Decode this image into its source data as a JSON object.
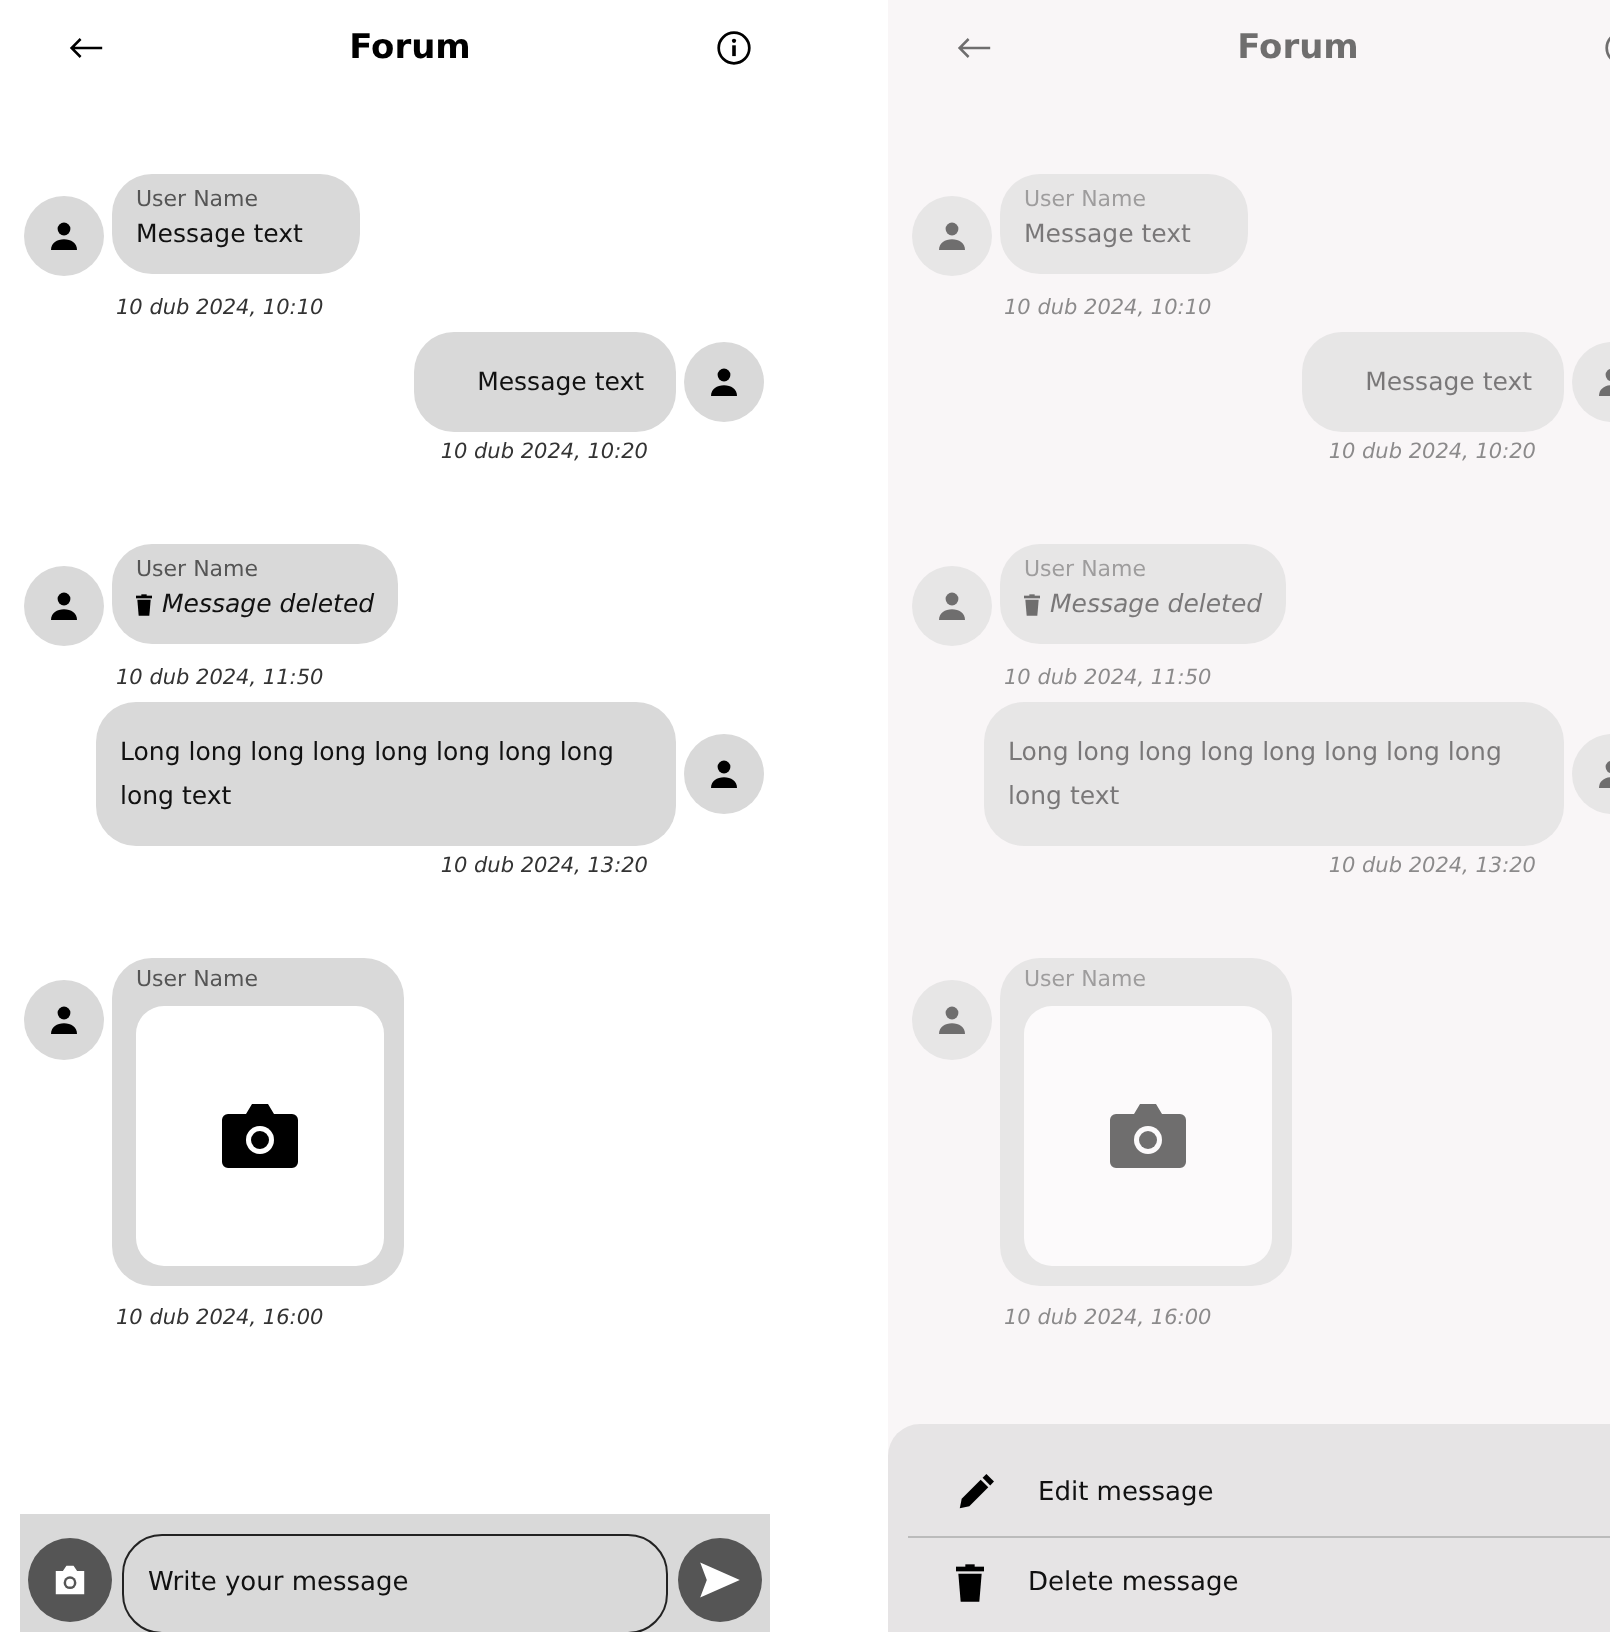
{
  "screens": [
    {
      "kind": "chat",
      "dimmed": false,
      "header": {
        "title": "Forum"
      },
      "messages": [
        {
          "kind": "incoming",
          "author": "User Name",
          "text": "Message text",
          "time": "10 dub 2024, 10:10"
        },
        {
          "kind": "outgoing",
          "text": "Message text",
          "time": "10 dub 2024, 10:20"
        },
        {
          "kind": "deleted",
          "author": "User Name",
          "text": "Message deleted",
          "time": "10 dub 2024, 11:50"
        },
        {
          "kind": "outgoing",
          "text": "Long long long long long long long long long text",
          "time": "10 dub 2024, 13:20"
        },
        {
          "kind": "photo",
          "author": "User Name",
          "time": "10 dub 2024, 16:00"
        }
      ],
      "composer": {
        "placeholder": "Write your message"
      }
    },
    {
      "kind": "chat",
      "dimmed": true,
      "header": {
        "title": "Forum"
      },
      "messages": [
        {
          "kind": "incoming",
          "author": "User Name",
          "text": "Message text",
          "time": "10 dub 2024, 10:10"
        },
        {
          "kind": "outgoing",
          "text": "Message text",
          "time": "10 dub 2024, 10:20"
        },
        {
          "kind": "deleted",
          "author": "User Name",
          "text": "Message deleted",
          "time": "10 dub 2024, 11:50"
        },
        {
          "kind": "outgoing",
          "text": "Long long long long long long long long long text",
          "time": "10 dub 2024, 13:20"
        },
        {
          "kind": "photo",
          "author": "User Name",
          "time": "10 dub 2024, 16:00"
        }
      ],
      "menu": [
        {
          "kind": "edit",
          "label": "Edit message"
        },
        {
          "kind": "delete",
          "label": "Delete message"
        }
      ]
    }
  ]
}
